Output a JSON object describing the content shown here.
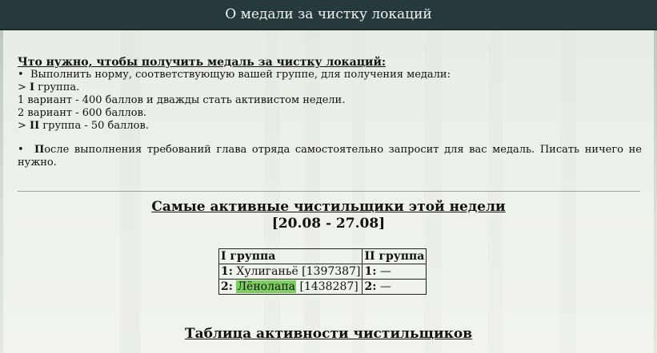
{
  "header": {
    "title": "О медали за чистку локаций"
  },
  "requirements": {
    "title": "Что нужно, чтобы получить медаль за чистку локаций:",
    "bullet1_text": "Выполнить норму, соответствующую вашей группе, для получения медали:",
    "group1_prefix": "> ",
    "group1_num": "I",
    "group1_suffix": " группа.",
    "variant1": "1 вариант - 400 баллов и дважды стать активистом недели.",
    "variant2": "2 вариант - 600 баллов.",
    "group2_prefix": "> ",
    "group2_num": "II",
    "group2_suffix": " группа - 50 баллов.",
    "bullet2_first_letter": "П",
    "bullet2_text": "осле выполнения требований глава отряда самостоятельно запросит для вас медаль. Писать ничего не нужно.",
    "bullet_symbol": "•"
  },
  "weekly": {
    "title": "Самые активные чистильщики этой недели",
    "range": "[20.08 - 27.08]",
    "table": {
      "headers": [
        "I группа",
        "II группа"
      ],
      "rows": [
        {
          "rank": "1:",
          "g1_name": "Хулиганьё",
          "g1_id": " [1397387]",
          "g2_rank": "1:",
          "g2_value": " —"
        },
        {
          "rank": "2:",
          "g1_name": "Лёнолапа",
          "g1_id": " [1438287]",
          "g2_rank": "2:",
          "g2_value": " —"
        }
      ]
    }
  },
  "activity": {
    "title": "Таблица активности чистильщиков"
  },
  "colors": {
    "header_bg": "#263a3c",
    "highlight": "#7ccf5e"
  }
}
